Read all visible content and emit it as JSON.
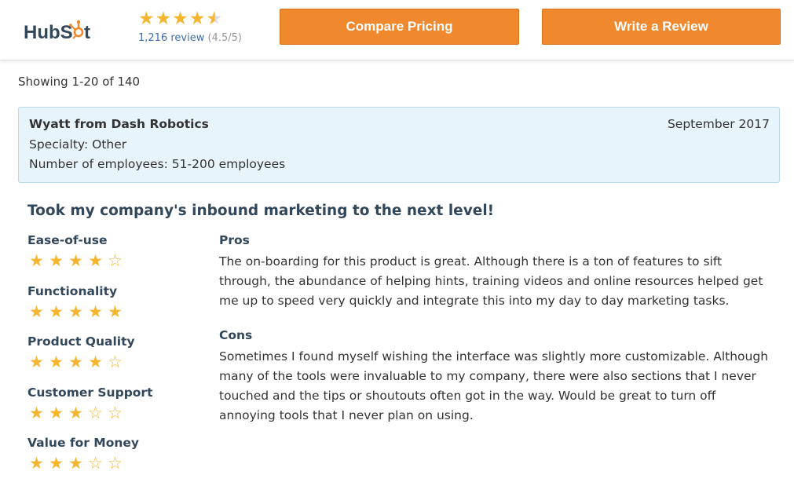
{
  "header": {
    "logo_text": "HubSpot",
    "rating_stars": "★★★★★",
    "review_count": "1,216 review",
    "review_avg": "(4.5/5)",
    "compare_label": "Compare Pricing",
    "write_label": "Write a Review",
    "accent_color": "#f0892d",
    "star_color": "#f5b52e"
  },
  "listing": {
    "showing": "Showing 1-20 of 140"
  },
  "reviewer": {
    "name": "Wyatt from Dash Robotics",
    "date": "September 2017",
    "specialty": "Specialty: Other",
    "employees": "Number of employees: 51-200 employees"
  },
  "review": {
    "title": "Took my company's inbound marketing to the next level!",
    "ratings": [
      {
        "label": "Ease-of-use",
        "stars": 4
      },
      {
        "label": "Functionality",
        "stars": 5
      },
      {
        "label": "Product Quality",
        "stars": 4
      },
      {
        "label": "Customer Support",
        "stars": 3
      },
      {
        "label": "Value for Money",
        "stars": 3
      }
    ],
    "pros_heading": "Pros",
    "pros_text": "The on-boarding for this product is great. Although there is a ton of features to sift through, the abundance of helping hints, training videos and online resources helped get me up to speed very quickly and integrate this into my day to day marketing tasks.",
    "cons_heading": "Cons",
    "cons_text": "Sometimes I found myself wishing the interface was slightly more customizable. Although many of the tools were invaluable to my company, there were also sections that I never touched and the tips or shoutouts often got in the way. Would be great to turn off annoying tools that I never plan on using."
  }
}
